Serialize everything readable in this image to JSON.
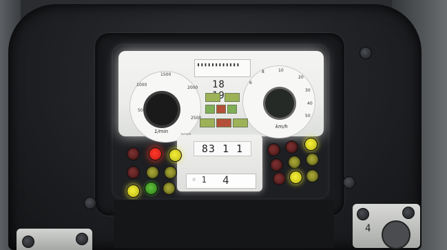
{
  "rpm_gauge": {
    "ticks": [
      "500",
      "1000",
      "1500",
      "2000",
      "2500",
      "3000"
    ],
    "unit": "1/min"
  },
  "speed_gauge": {
    "ticks": [
      "6",
      "8",
      "10",
      "20",
      "30",
      "40",
      "50"
    ],
    "unit": "km/h"
  },
  "top_display": {
    "bar_row": "▮▮▮▮▮▮▮▮▮▮▮▮",
    "clock": "18 19"
  },
  "odometer": "83 1 1",
  "gear": {
    "selector": "◦ 1",
    "value": "4"
  },
  "switch_label": "4",
  "colors": {
    "lamp_red_active": "#ff3b2b",
    "lamp_yellow": "#f6f03a",
    "lamp_green": "#61c23a",
    "indicator_green": "#7fae57",
    "indicator_red": "#b3503a"
  },
  "icons": [
    "rpm-needle-hub-icon",
    "speed-needle-hub-icon",
    "warning-lamp-icon",
    "hazard-lamp-icon",
    "beacon-lamp-icon"
  ]
}
